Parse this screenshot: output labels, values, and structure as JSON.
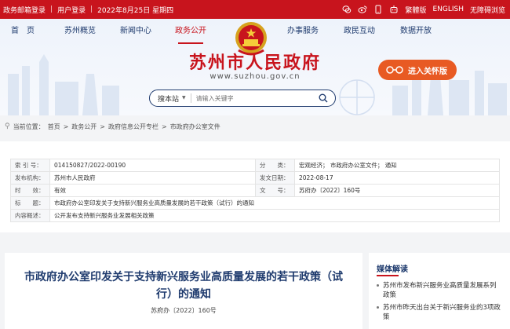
{
  "topbar": {
    "links": [
      "政务邮箱登录",
      "用户登录"
    ],
    "date": "2022年8月25日 星期四",
    "right": {
      "traditional": "繁體版",
      "english": "ENGLISH",
      "accessible": "无障碍浏览"
    }
  },
  "nav": {
    "items": [
      "首　页",
      "苏州概览",
      "新闻中心",
      "政务公开",
      "办事服务",
      "政民互动",
      "数据开放"
    ]
  },
  "site": {
    "title": "苏州市人民政府",
    "url": "www.suzhou.gov.cn",
    "care_label": "进入关怀版"
  },
  "search": {
    "scope": "搜本站",
    "placeholder": "请输入关键字"
  },
  "breadcrumb": {
    "prefix": "当前位置：",
    "items": [
      "首页",
      "政务公开",
      "政府信息公开专栏",
      "市政府办公室文件"
    ],
    "sep": ">"
  },
  "info": {
    "index_key": "索 引 号：",
    "index_val": "014150827/2022-00190",
    "class_key": "分　　类：",
    "class_val": "宏观经济； 市政府办公室文件； 通知",
    "org_key": "发布机构：",
    "org_val": "苏州市人民政府",
    "date_key": "发文日期：",
    "date_val": "2022-08-17",
    "valid_key": "时　　效：",
    "valid_val": "有效",
    "docno_key": "文　　号：",
    "docno_val": "苏府办〔2022〕160号",
    "title_key": "标　　题：",
    "title_val": "市政府办公室印发关于支持新兴服务业高质量发展的若干政策（试行）的通知",
    "summary_key": "内容概述：",
    "summary_val": "公开发布支持新兴服务业发展相关政策"
  },
  "article": {
    "title_line1": "市政府办公室印发关于支持新兴服务业高质量发展的若干政策（试",
    "title_line2": "行）的通知",
    "doc_no": "苏府办〔2022〕160号"
  },
  "side": {
    "heading": "媒体解读",
    "items": [
      "苏州市发布新兴服务业高质量发展系列政策",
      "苏州市昨天出台关于新兴服务业的3项政策"
    ]
  },
  "colors": {
    "brand_red": "#c8141d",
    "navy": "#1f3b6e",
    "care_orange": "#e85a23"
  }
}
